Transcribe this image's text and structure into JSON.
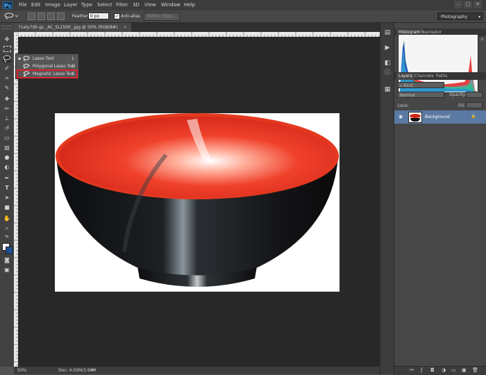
{
  "app": {
    "logo": "Ps"
  },
  "menu": [
    "File",
    "Edit",
    "Image",
    "Layer",
    "Type",
    "Select",
    "Filter",
    "3D",
    "View",
    "Window",
    "Help"
  ],
  "window_controls": [
    "–",
    "□",
    "✕"
  ],
  "options_bar": {
    "feather_label": "Feather:",
    "feather_value": "0 px",
    "antialias_label": "Anti-alias",
    "refine_edge_label": "Refine Edge...",
    "workspace_value": "Photography"
  },
  "document": {
    "tab_title": "71ely7d5-gL._AC_SL1500_.jpg @ 50% (RGB/8#)",
    "tab_close": "×"
  },
  "flyout": {
    "items": [
      {
        "label": "Lasso Tool",
        "key": "L",
        "icon": "lasso-icon",
        "active": true
      },
      {
        "label": "Polygonal Lasso Tool",
        "key": "L",
        "icon": "polygonal-lasso-icon",
        "active": false
      },
      {
        "label": "Magnetic Lasso Tool",
        "key": "L",
        "icon": "magnetic-lasso-icon",
        "active": false,
        "highlighted": true
      }
    ],
    "highlight_color": "#e0202a"
  },
  "status": {
    "zoom": "50%",
    "doc": "Doc: 4.03M/3.96M"
  },
  "panels": {
    "top_tabs": [
      "Histogram",
      "Navigator"
    ],
    "layer_tabs": [
      "Layers",
      "Channels",
      "Paths"
    ],
    "kind_label": "Kind",
    "blend_mode": "Normal",
    "opacity_label": "Opacity:",
    "lock_label": "Lock:",
    "fill_label": "Fill:",
    "layer_name": "Background"
  },
  "colors": {
    "accent": "#5a7aa3",
    "bowl_red": "#e8321f",
    "bowl_black": "#141517"
  }
}
